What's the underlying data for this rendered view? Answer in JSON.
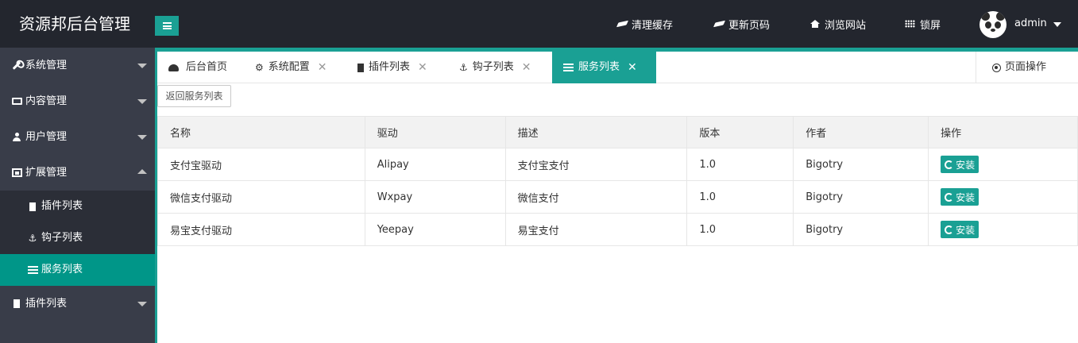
{
  "header": {
    "logo": "资源邦后台管理",
    "nav": [
      {
        "label": "清理缓存",
        "icon": "eraser-icon"
      },
      {
        "label": "更新页码",
        "icon": "eraser-icon"
      },
      {
        "label": "浏览网站",
        "icon": "home-icon"
      },
      {
        "label": "锁屏",
        "icon": "grid-icon"
      }
    ],
    "user": "admin"
  },
  "sidebar": {
    "items": [
      {
        "label": "系统管理",
        "icon": "wrench-icon"
      },
      {
        "label": "内容管理",
        "icon": "monitor-icon"
      },
      {
        "label": "用户管理",
        "icon": "user-icon"
      },
      {
        "label": "扩展管理",
        "icon": "expand-icon"
      },
      {
        "label": "插件列表",
        "icon": "chip-icon"
      }
    ],
    "subitems": [
      {
        "label": "插件列表",
        "icon": "chip-icon"
      },
      {
        "label": "钩子列表",
        "icon": "anchor-icon"
      },
      {
        "label": "服务列表",
        "icon": "list-icon"
      }
    ]
  },
  "tabs": [
    {
      "label": "后台首页",
      "icon": "dashboard-icon"
    },
    {
      "label": "系统配置",
      "icon": "gear-icon"
    },
    {
      "label": "插件列表",
      "icon": "chip-icon"
    },
    {
      "label": "钩子列表",
      "icon": "anchor-icon"
    },
    {
      "label": "服务列表",
      "icon": "list-icon"
    }
  ],
  "page_ops": "页面操作",
  "back_button": "返回服务列表",
  "table": {
    "headers": [
      "名称",
      "驱动",
      "描述",
      "版本",
      "作者",
      "操作"
    ],
    "rows": [
      {
        "name": "支付宝驱动",
        "driver": "Alipay",
        "desc": "支付宝支付",
        "version": "1.0",
        "author": "Bigotry",
        "action": "安装"
      },
      {
        "name": "微信支付驱动",
        "driver": "Wxpay",
        "desc": "微信支付",
        "version": "1.0",
        "author": "Bigotry",
        "action": "安装"
      },
      {
        "name": "易宝支付驱动",
        "driver": "Yeepay",
        "desc": "易宝支付",
        "version": "1.0",
        "author": "Bigotry",
        "action": "安装"
      }
    ]
  },
  "colors": {
    "header_bg": "#23262e",
    "sidebar_bg": "#393d49",
    "sidebar_sub_bg": "#2b2e37",
    "accent": "#1aa094",
    "active": "#009688"
  }
}
